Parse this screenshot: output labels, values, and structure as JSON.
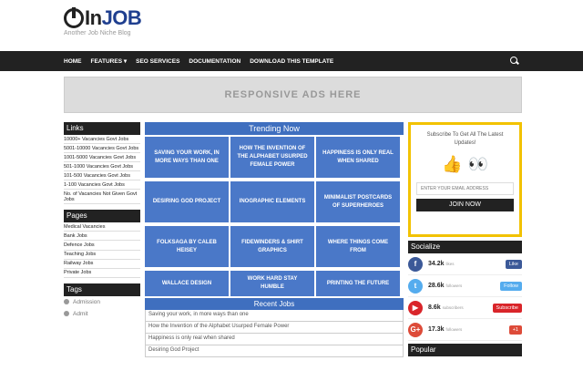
{
  "header": {
    "logo_text": "InJOB",
    "tagline": "Another Job Niche Blog"
  },
  "nav": {
    "items": [
      "HOME",
      "FEATURES ▾",
      "SEO SERVICES",
      "DOCUMENTATION",
      "DOWNLOAD THIS TEMPLATE"
    ],
    "search_icon": "search-icon"
  },
  "ads": {
    "text": "RESPONSIVE ADS HERE"
  },
  "left": {
    "links_title": "Links",
    "links": [
      "10000+ Vacancies Govt Jobs",
      "5001-10000 Vacancies Govt Jobs",
      "1001-5000 Vacancies Govt Jobs",
      "501-1000 Vacancies Govt Jobs",
      "101-500 Vacancies Govt Jobs",
      "1-100 Vacancies Govt Jobs",
      "No. of Vacancies Not Given Govt Jobs"
    ],
    "pages_title": "Pages",
    "pages": [
      "Medical Vacancies",
      "Bank Jobs",
      "Defence Jobs",
      "Teaching Jobs",
      "Railway Jobs",
      "Private Jobs"
    ],
    "tags_title": "Tags",
    "tags": [
      "Admission",
      "Admit"
    ]
  },
  "center": {
    "trending_title": "Trending Now",
    "trending": [
      "SAVING YOUR WORK, IN MORE WAYS THAN ONE",
      "HOW THE INVENTION OF THE ALPHABET USURPED FEMALE POWER",
      "HAPPINESS IS ONLY REAL WHEN SHARED",
      "DESIRING GOD PROJECT",
      "INOGRAPHIC ELEMENTS",
      "MINIMALIST POSTCARDS OF SUPERHEROES",
      "FOLKSAGA BY CALEB HEISEY",
      "FIDEWINDERS & SHIRT GRAPHICS",
      "WHERE THINGS COME FROM",
      "WALLACE DESIGN",
      "WORK HARD STAY HUMBLE",
      "PRINTING THE FUTURE"
    ],
    "recent_title": "Recent Jobs",
    "recent": [
      "Saving your work, in more ways than one",
      "How the Invention of the Alphabet Usurped Female Power",
      "Happiness is only real when shared",
      "Desiring God Project"
    ]
  },
  "right": {
    "subscribe_text": "Subscribe To Get All The Latest Updates!",
    "email_placeholder": "ENTER YOUR EMAIL ADDRESS",
    "join_label": "JOIN NOW",
    "socialize_title": "Socialize",
    "social": [
      {
        "icon": "facebook-icon",
        "glyph": "f",
        "count": "34.2k",
        "label": "likes",
        "button": "Like",
        "color": "#3b5998",
        "btn_color": "#3b5998"
      },
      {
        "icon": "twitter-icon",
        "glyph": "t",
        "count": "28.6k",
        "label": "followers",
        "button": "Follow",
        "color": "#55acee",
        "btn_color": "#55acee"
      },
      {
        "icon": "youtube-icon",
        "glyph": "▶",
        "count": "8.6k",
        "label": "subscribers",
        "button": "Subscribe",
        "color": "#d9252a",
        "btn_color": "#d9252a"
      },
      {
        "icon": "googleplus-icon",
        "glyph": "G+",
        "count": "17.3k",
        "label": "followers",
        "button": "+1",
        "color": "#dd4b39",
        "btn_color": "#dd4b39"
      }
    ],
    "popular_title": "Popular"
  }
}
